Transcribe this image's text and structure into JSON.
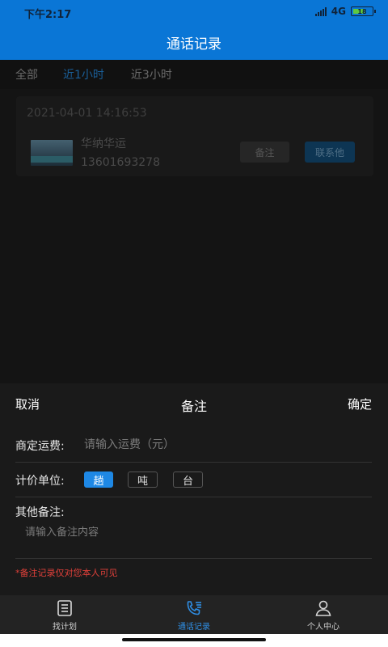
{
  "status_bar": {
    "time": "下午2:17",
    "network": "4G",
    "battery": "18"
  },
  "header": {
    "title": "通话记录"
  },
  "tabs": [
    {
      "label": "全部",
      "active": false
    },
    {
      "label": "近1小时",
      "active": true
    },
    {
      "label": "近3小时",
      "active": false
    }
  ],
  "record": {
    "timestamp": "2021-04-01 14:16:53",
    "name": "华纳华运",
    "phone": "13601693278",
    "note_button": "备注",
    "contact_button": "联系他"
  },
  "note_sheet": {
    "cancel": "取消",
    "title": "备注",
    "confirm": "确定",
    "fee_label": "商定运费:",
    "fee_placeholder": "请输入运费（元）",
    "unit_label": "计价单位:",
    "units": [
      {
        "label": "趟",
        "selected": true
      },
      {
        "label": "吨",
        "selected": false
      },
      {
        "label": "台",
        "selected": false
      }
    ],
    "other_label": "其他备注:",
    "other_placeholder": "请输入备注内容",
    "privacy_notice": "*备注记录仅对您本人可见"
  },
  "bottom_nav": [
    {
      "label": "找计划",
      "icon": "list-icon",
      "active": false
    },
    {
      "label": "通话记录",
      "icon": "phone-list-icon",
      "active": true
    },
    {
      "label": "个人中心",
      "icon": "person-icon",
      "active": false
    }
  ],
  "colors": {
    "primary": "#0a76d6",
    "accent": "#1e88e5",
    "notice": "#e0403a"
  }
}
